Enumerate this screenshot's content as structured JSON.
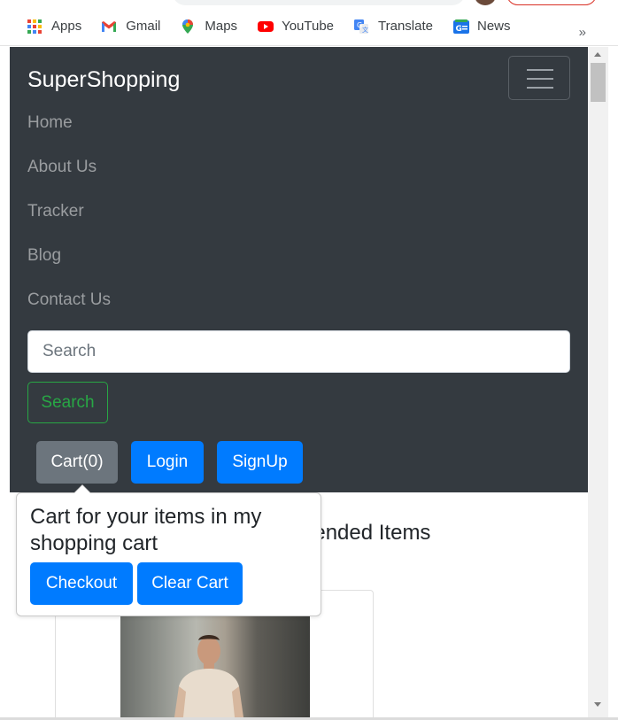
{
  "bookmarks": [
    {
      "label": "Apps",
      "icon": "apps-grid-icon"
    },
    {
      "label": "Gmail",
      "icon": "gmail-icon"
    },
    {
      "label": "Maps",
      "icon": "maps-pin-icon"
    },
    {
      "label": "YouTube",
      "icon": "youtube-icon"
    },
    {
      "label": "Translate",
      "icon": "translate-icon"
    },
    {
      "label": "News",
      "icon": "news-icon"
    }
  ],
  "bookmarks_more": "»",
  "navbar": {
    "brand": "SuperShopping",
    "links": [
      "Home",
      "About Us",
      "Tracker",
      "Blog",
      "Contact Us"
    ],
    "search_placeholder": "Search",
    "search_button": "Search",
    "cart_button": "Cart(0)",
    "login_button": "Login",
    "signup_button": "SignUp"
  },
  "popover": {
    "text": "Cart for your items in my shopping cart",
    "checkout": "Checkout",
    "clear_cart": "Clear Cart"
  },
  "content": {
    "heading_visible": "nended Items"
  },
  "colors": {
    "navbar_bg": "#343a40",
    "primary": "#007bff",
    "secondary": "#6c757d",
    "success": "#28a745"
  }
}
